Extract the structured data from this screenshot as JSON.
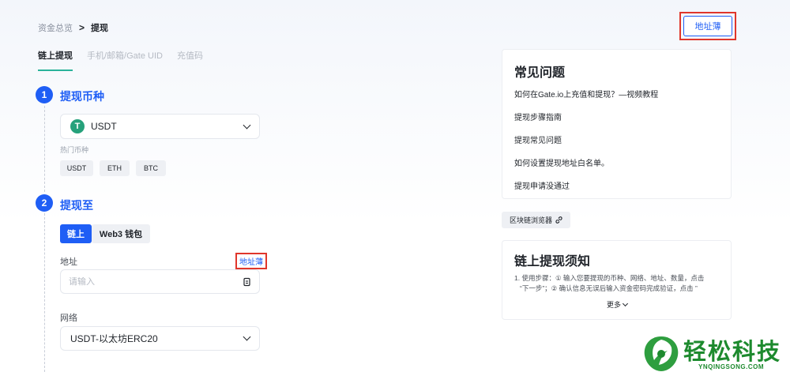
{
  "breadcrumb": {
    "parent": "资金总览",
    "separator": ">",
    "current": "提现"
  },
  "tabs": [
    {
      "label": "链上提现",
      "active": true
    },
    {
      "label": "手机/邮箱/Gate UID",
      "active": false
    },
    {
      "label": "充值码",
      "active": false
    }
  ],
  "step1": {
    "number": "1",
    "title": "提现币种",
    "coin_icon": "T",
    "selected_coin": "USDT",
    "hot_label": "热门币种",
    "hot_coins": [
      "USDT",
      "ETH",
      "BTC"
    ]
  },
  "step2": {
    "number": "2",
    "title": "提现至",
    "segments": [
      "链上",
      "Web3 钱包"
    ],
    "address_label": "地址",
    "address_book_link": "地址薄",
    "address_placeholder": "请输入",
    "network_label": "网络",
    "network_value": "USDT-以太坊ERC20"
  },
  "top_address_book": "地址薄",
  "faq": {
    "title": "常见问题",
    "items": [
      "如何在Gate.io上充值和提现？—视频教程",
      "提现步骤指南",
      "提现常见问题",
      "如何设置提现地址白名单。",
      "提现申请没通过"
    ]
  },
  "explorer_button": "区块链浏览器",
  "notice": {
    "title": "链上提现须知",
    "line1": "1.  使用步骤：① 输入您要提现的币种、网络、地址、数量，点击",
    "line2": "“下一步”；② 确认信息无误后输入资金密码完成验证，点击 ”",
    "more": "更多"
  },
  "watermark": {
    "text": "轻松科技",
    "sub": "YNQINGSONG.COM"
  },
  "colors": {
    "accent": "#1f5ef5",
    "tab_underline": "#2ab39a",
    "highlight_box": "#e0362b",
    "tether": "#26a17b"
  }
}
